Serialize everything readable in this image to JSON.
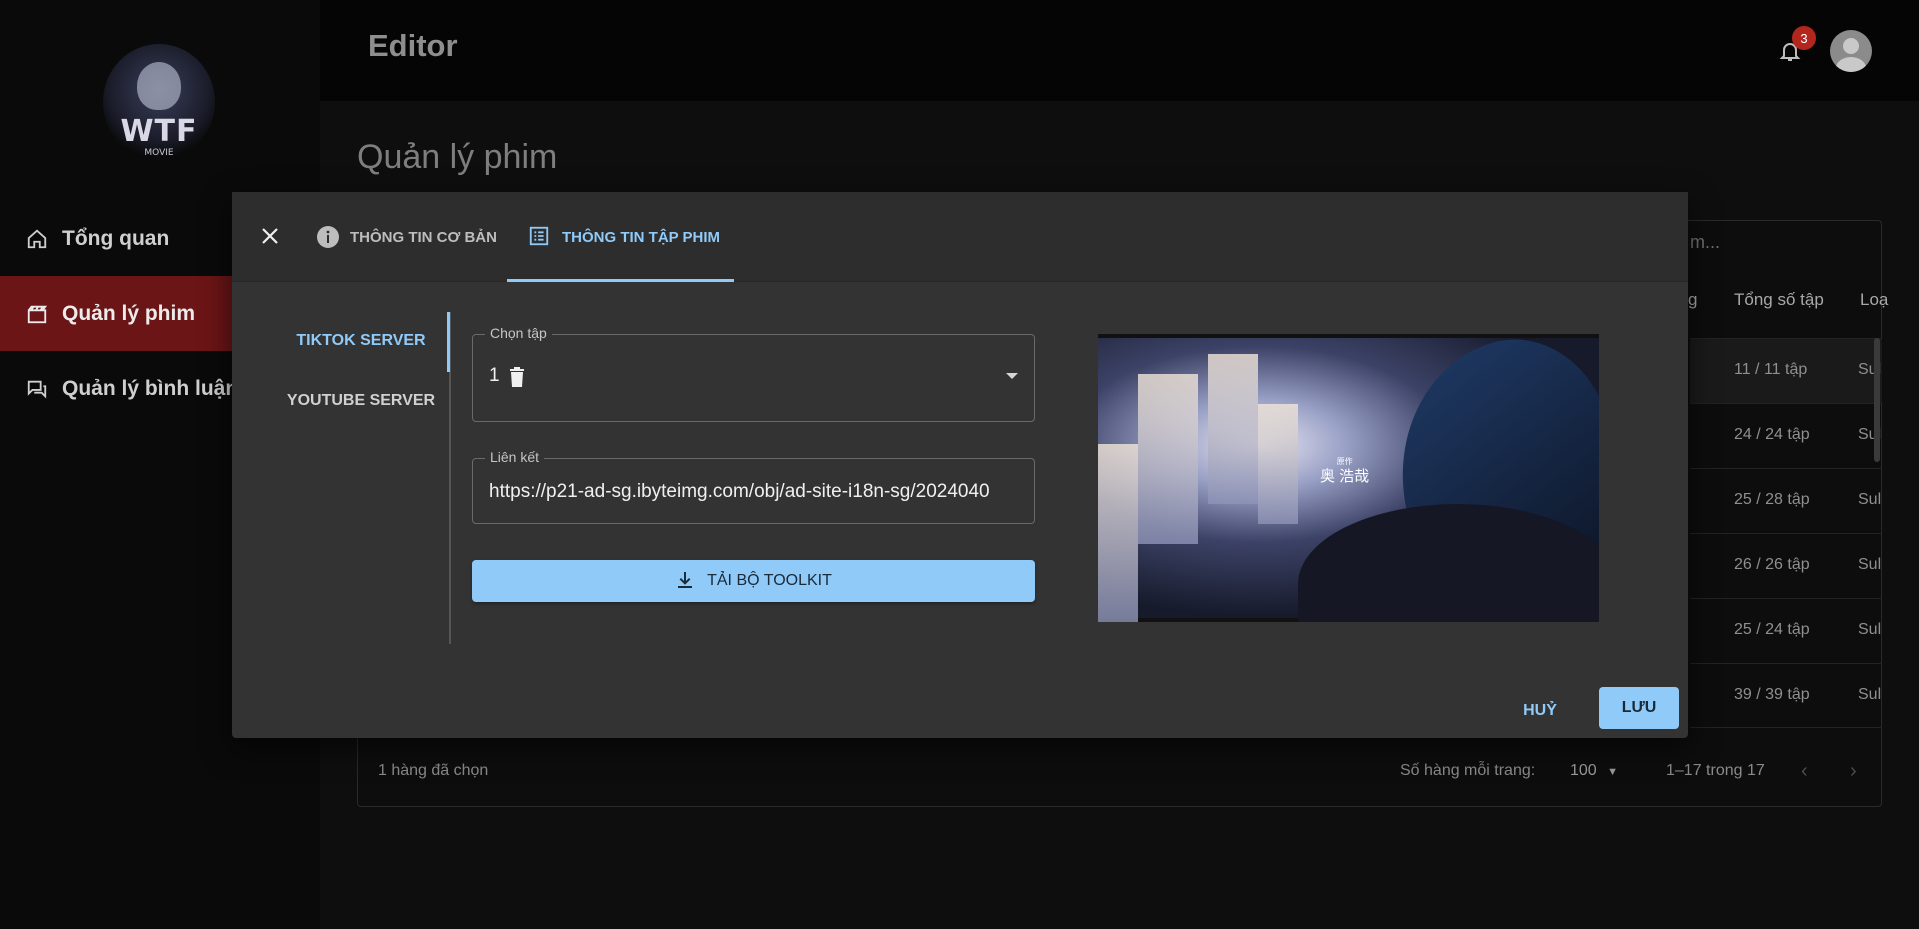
{
  "sidebar": {
    "logo": {
      "text": "WTF",
      "subtext": "MOVIE"
    },
    "items": [
      {
        "label": "Tổng quan",
        "icon": "home-icon",
        "active": false
      },
      {
        "label": "Quản lý phim",
        "icon": "clapperboard-icon",
        "active": true
      },
      {
        "label": "Quản lý bình luận",
        "icon": "chat-icon",
        "active": false
      }
    ]
  },
  "header": {
    "title": "Editor",
    "notification_count": "3"
  },
  "page": {
    "title": "Quản lý phim",
    "search_placeholder": "m...",
    "table": {
      "headers": [
        "g",
        "Tổng số tập",
        "Loạ"
      ],
      "rows": [
        {
          "episodes": "11 / 11 tập",
          "type": "Sul"
        },
        {
          "episodes": "24 / 24 tập",
          "type": "Sul"
        },
        {
          "episodes": "25 / 28 tập",
          "type": "Sul"
        },
        {
          "episodes": "26 / 26 tập",
          "type": "Sul"
        },
        {
          "episodes": "25 / 24 tập",
          "type": "Sul"
        },
        {
          "episodes": "39 / 39 tập",
          "type": "Sul"
        }
      ]
    },
    "footer": {
      "selected": "1 hàng đã chọn",
      "rows_per_page_label": "Số hàng mỗi trang:",
      "rows_per_page_value": "100",
      "range": "1–17 trong 17"
    }
  },
  "modal": {
    "tabs": [
      {
        "label": "THÔNG TIN CƠ BẢN",
        "icon": "info-icon",
        "active": false
      },
      {
        "label": "THÔNG TIN TẬP PHIM",
        "icon": "list-icon",
        "active": true
      }
    ],
    "servers": [
      {
        "label": "TIKTOK SERVER",
        "active": true
      },
      {
        "label": "YOUTUBE SERVER",
        "active": false
      }
    ],
    "episode_select": {
      "label": "Chọn tập",
      "value": "1"
    },
    "link_field": {
      "label": "Liên kết",
      "value": "https://p21-ad-sg.ibyteimg.com/obj/ad-site-i18n-sg/2024040"
    },
    "download_button": "TẢI BỘ TOOLKIT",
    "preview": {
      "credit_small": "原作",
      "credit_main": "奥 浩哉"
    },
    "cancel_button": "HUỶ",
    "save_button": "LƯU"
  },
  "colors": {
    "accent": "#90caf9",
    "active_nav": "#6b1516",
    "badge": "#b3261e",
    "modal_bg": "#333333"
  }
}
